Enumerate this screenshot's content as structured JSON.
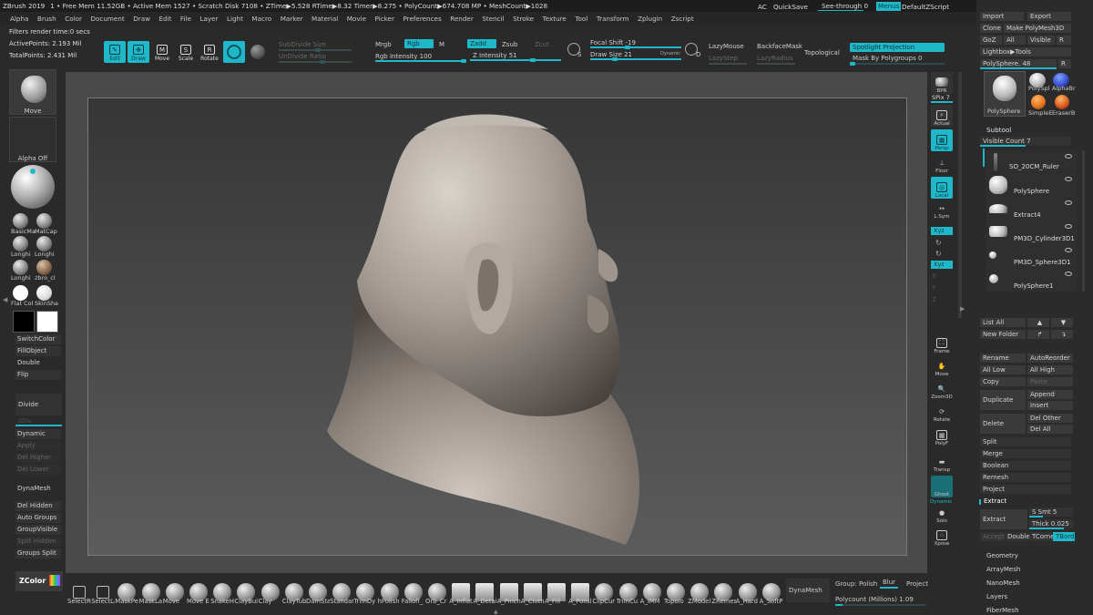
{
  "title": {
    "app": "ZBrush 2019",
    "stats": "1   • Free Mem 11.52GB • Active Mem 1527 • Scratch Disk 7108 •  ZTime▶5.528 RTime▶8.32 Timer▶8.275 • PolyCount▶674.708 MP  • MeshCount▶1028",
    "ac": "AC",
    "quicksave": "QuickSave",
    "see_through": "See-through  0",
    "menus": "Menus",
    "script": "DefaultZScript"
  },
  "menu": [
    "Alpha",
    "Brush",
    "Color",
    "Document",
    "Draw",
    "Edit",
    "File",
    "Layer",
    "Light",
    "Macro",
    "Marker",
    "Material",
    "Movie",
    "Picker",
    "Preferences",
    "Render",
    "Stencil",
    "Stroke",
    "Texture",
    "Tool",
    "Transform",
    "Zplugin",
    "Zscript"
  ],
  "info": {
    "render": "Filters render time:0 secs",
    "active_points": "ActivePoints: 2.193 Mil",
    "total_points": "TotalPoints: 2.431 Mil"
  },
  "shelf": {
    "edit": "Edit",
    "draw": "Draw",
    "move": "Move",
    "scale": "Scale",
    "rotate": "Rotate",
    "subdivide": "SubDivide Size",
    "undivide": "UnDivide Ratio",
    "mrgb": "Mrgb",
    "rgb": "Rgb",
    "m": "M",
    "rgb_intensity": "Rgb Intensity 100",
    "zadd": "Zadd",
    "zsub": "Zsub",
    "zcut": "Zcut",
    "z_intensity": "Z Intensity 51",
    "focal_shift": "Focal Shift -19",
    "draw_size": "Draw Size 21",
    "dynamic": "Dynamic",
    "s_label": "S",
    "d_label": "D",
    "lazymouse": "LazyMouse",
    "lazystep": "LazyStep",
    "lazyradius": "LazyRadius",
    "backface": "BackfaceMask",
    "topological": "Topological",
    "spotlight": "Spotlight Projection",
    "mask_polygroups": "Mask By Polygroups 0"
  },
  "left": {
    "move": "Move",
    "alpha_off": "Alpha Off",
    "materials": [
      "BasicMa",
      "MatCap",
      "Longhi",
      "Longhi",
      "Longhi",
      "zbro_cl",
      "Flat Col",
      "SkinSha"
    ],
    "switch_color": "SwitchColor",
    "fill_object": "FillObject",
    "double": "Double",
    "flip": "Flip",
    "divide": "Divide",
    "sdiv": "SDiv",
    "dynamic": "Dynamic",
    "apply": "Apply",
    "del_higher": "Del Higher",
    "del_lower": "Del Lower",
    "dynamesh": "DynaMesh",
    "del_hidden": "Del Hidden",
    "auto_groups": "Auto Groups",
    "group_visible": "GroupVisible",
    "split_hidden": "Split Hidden",
    "groups_split": "Groups Split",
    "zcolor": "ZColor"
  },
  "right_shelf": {
    "bpr": "BPR",
    "spix": "SPix 7",
    "actual": "Actual",
    "persp": "Persp",
    "floor": "Floor",
    "local": "Local",
    "lsym": "L.Sym",
    "xyz1": "Xyz",
    "xyz2": "Xyz",
    "x": "X",
    "y": "Y",
    "z": "Z",
    "frame": "Frame",
    "move": "Move",
    "zoom3d": "Zoom3D",
    "rotate": "Rotate",
    "polyf": "PolyF",
    "transp": "Transp",
    "ghost": "Ghost",
    "dynamic": "Dynamic",
    "solo": "Solo",
    "xpose": "Xpose"
  },
  "tray": {
    "import": "Import",
    "export": "Export",
    "clone": "Clone",
    "make_polymesh": "Make PolyMesh3D",
    "goz": "GoZ",
    "all": "All",
    "visible": "Visible",
    "r": "R",
    "lightbox_tools": "Lightbox▶Tools",
    "polysphere": "PolySphere.  48",
    "r2": "R",
    "tool_thumbs": [
      "PolySphere",
      "PolySpl",
      "AlphaBr",
      "SimpleE",
      "EraserB"
    ],
    "subtool": "Subtool",
    "visible_count": "Visible Count 7",
    "subtools": [
      "SO_20CM_Ruler",
      "PolySphere",
      "Extract4",
      "PM3D_Cylinder3D1",
      "PM3D_Sphere3D1",
      "PolySphere1"
    ],
    "list_all": "List All",
    "new_folder": "New Folder",
    "rename": "Rename",
    "auto_reorder": "AutoReorder",
    "all_low": "All Low",
    "all_high": "All High",
    "copy": "Copy",
    "paste": "Paste",
    "duplicate": "Duplicate",
    "append": "Append",
    "insert": "Insert",
    "delete": "Delete",
    "del_other": "Del Other",
    "del_all": "Del All",
    "split": "Split",
    "merge": "Merge",
    "boolean": "Boolean",
    "remesh": "Remesh",
    "project": "Project",
    "extract_section": "Extract",
    "extract_btn": "Extract",
    "s_smt": "S Smt 5",
    "thick": "Thick 0.025",
    "accept": "Accept",
    "double": "Double",
    "tcorne": "TCorne",
    "tborder": "TBorde",
    "geometry": "Geometry",
    "arraymesh": "ArrayMesh",
    "nanomesh": "NanoMesh",
    "layers": "Layers",
    "fibermesh": "FiberMesh"
  },
  "bottom": {
    "brushes": [
      "SelectRe",
      "SelectLa",
      "MaskPe",
      "MaskLa",
      "Move",
      "Move E",
      "SnakeH",
      "ClayBui",
      "Clay",
      "ClayTub",
      "DamSta",
      "Standar",
      "TrimDy",
      "hPolish",
      "Falloff_",
      "Orb_Cr",
      "A_Inflat",
      "A_Detai",
      "A_Pinch",
      "A_Cloth",
      "A_Fill",
      "A_Polisl",
      "ClipCur",
      "TrimCu",
      "A_IMM",
      "Topolo",
      "ZModel",
      "ZRemes",
      "A_Hard",
      "A_SoftP"
    ],
    "dynamesh": "DynaMesh",
    "group": "Group:",
    "polish": "Polish",
    "blur": "Blur",
    "project": "Project",
    "polycount": "Polycount (Millions) 1.09"
  }
}
